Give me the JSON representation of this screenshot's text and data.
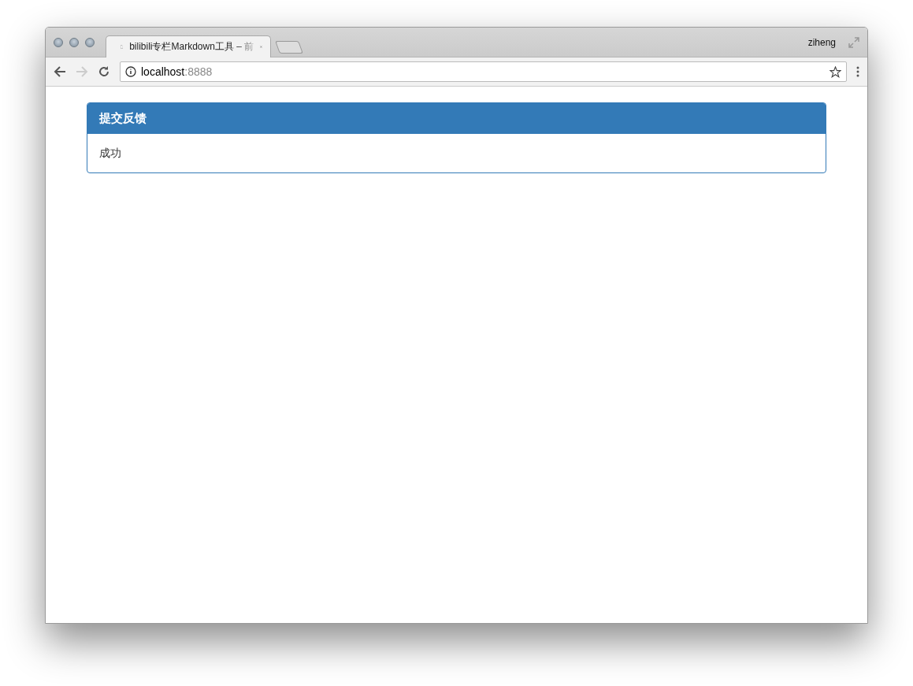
{
  "browser": {
    "tabs": [
      {
        "title": "bilibili专栏Markdown工具 – 前",
        "selected": true
      }
    ],
    "profile": "ziheng",
    "url": {
      "host": "localhost",
      "port": ":8888"
    },
    "forward_disabled": true
  },
  "panel": {
    "title": "提交反馈",
    "body": "成功"
  }
}
